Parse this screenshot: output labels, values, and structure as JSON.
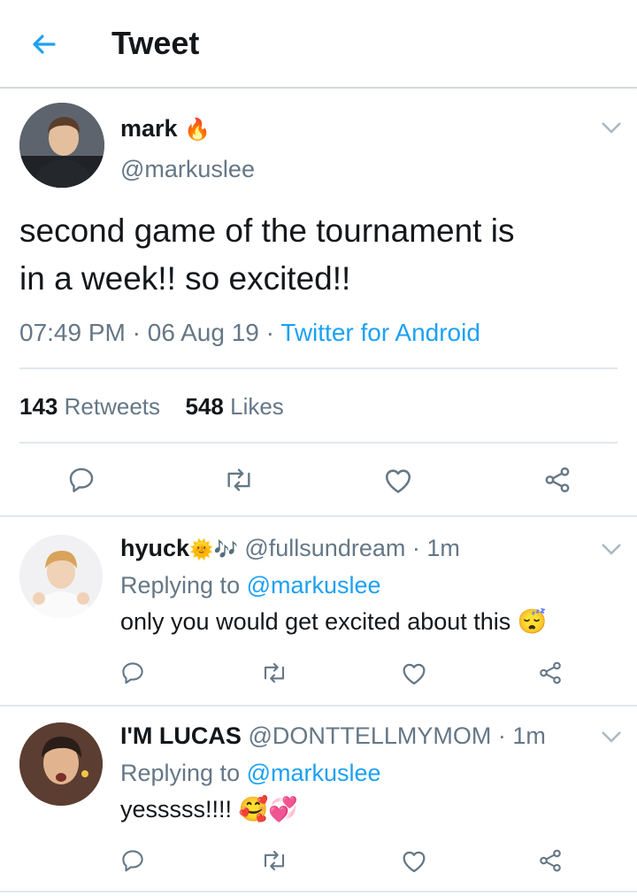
{
  "header": {
    "title": "Tweet"
  },
  "main_tweet": {
    "name": "mark",
    "name_emoji": "🔥",
    "handle": "@markuslee",
    "text_line1": "second game of the tournament is",
    "text_line2": "in a week!! so excited!!",
    "time": "07:49 PM",
    "date": "06 Aug 19",
    "source": "Twitter for Android",
    "retweets_count": "143",
    "retweets_label": "Retweets",
    "likes_count": "548",
    "likes_label": "Likes"
  },
  "replies": [
    {
      "name": "hyuck",
      "name_emoji": "🌞🎶",
      "handle": "@fullsundream",
      "time": "1m",
      "replying_label": "Replying to",
      "replying_to": "@markuslee",
      "text": "only you would get excited about this",
      "text_emoji": "😴"
    },
    {
      "name": "I'M LUCAS",
      "name_emoji": "",
      "handle": "@DONTTELLMYMOM",
      "time": "1m",
      "replying_label": "Replying to",
      "replying_to": "@markuslee",
      "text": "yesssss!!!!",
      "text_emoji": "🥰💞"
    }
  ],
  "colors": {
    "accent": "#1da1f2",
    "muted": "#657786",
    "divider": "#e1e8ed"
  }
}
